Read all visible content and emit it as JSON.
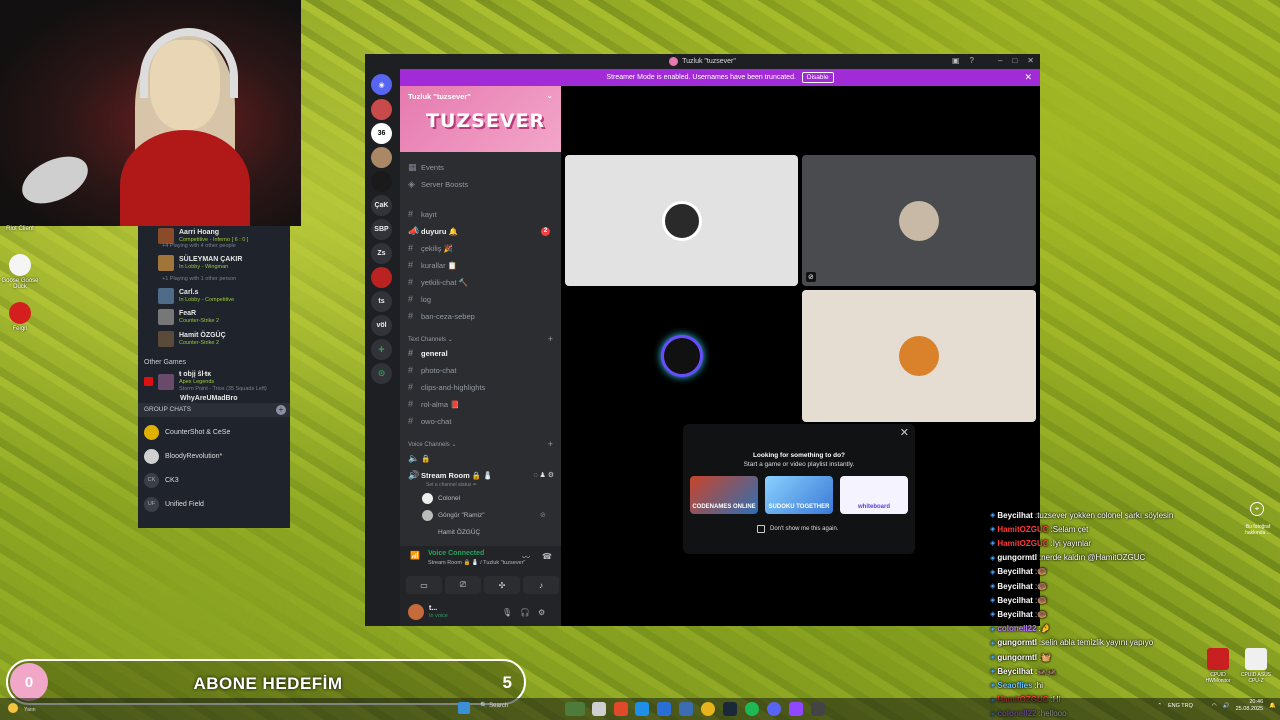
{
  "desktop": {
    "icons": [
      {
        "label": "Riot Client"
      },
      {
        "label": "Goose Goose Duck"
      },
      {
        "label": "Feign"
      }
    ]
  },
  "friends": {
    "playing_top_name": "Aarri Hoang",
    "playing_top_status": "Competitive - Inferno [ 6 : 0 ]",
    "playing_top_extra": "+4  Playing with 4 other people",
    "items": [
      {
        "name": "SÜLEYMAN ÇAKIR",
        "status": "In Lobby - Wingman",
        "extra": "+1  Playing with 1 other person"
      },
      {
        "name": "Carl.s",
        "status": "In Lobby - Competitive"
      },
      {
        "name": "FeaR",
        "status": "Counter-Strike 2"
      },
      {
        "name": "Hamit ÖZGÜÇ",
        "status": "Counter-Strike 2"
      }
    ],
    "other_games_label": "Other Games",
    "other_games": [
      {
        "name": "ŧ objį ŝŀŧĸ",
        "status": "Apex Legends",
        "extra": "Storm Point - Trios (35 Squads Left)"
      },
      {
        "name": "WhyAreUMadBro",
        "status": ""
      }
    ],
    "group_chats_label": "GROUP CHATS",
    "group_chats": [
      {
        "name": "CounterShot & CeSe",
        "initials": ""
      },
      {
        "name": "BloodyRevolution*",
        "initials": ""
      },
      {
        "name": "CK3",
        "initials": "CK"
      },
      {
        "name": "Unified Field",
        "initials": "UF"
      }
    ]
  },
  "discord": {
    "window_title": "Tuzluk \"tuzsever\"",
    "streamer_banner": "Streamer Mode is enabled. Usernames have been truncated.",
    "disable_label": "Disable",
    "servers": [
      "36",
      "ÇaK",
      "SBP",
      "Zs",
      "ts",
      "völ"
    ],
    "guild_name": "Tuzluk \"tuzsever\"",
    "banner_text": "TUZSEVER",
    "top_items": [
      "Events",
      "Server Boosts"
    ],
    "channels": [
      {
        "name": "kayıt",
        "bold": false
      },
      {
        "name": "duyuru 🔔",
        "bold": true,
        "badge": "2"
      },
      {
        "name": "çekiliş 🎉",
        "bold": false
      },
      {
        "name": "kurallar 📋",
        "bold": false
      },
      {
        "name": "yetkili-chat 🔨",
        "bold": false
      },
      {
        "name": "log",
        "bold": false
      },
      {
        "name": "ban-ceza-sebep",
        "bold": false
      }
    ],
    "text_category": "Text Channels",
    "text_channels": [
      {
        "name": "general",
        "bold": true
      },
      {
        "name": "photo-chat",
        "bold": false
      },
      {
        "name": "clips-and-highlights",
        "bold": false
      },
      {
        "name": "rol-alma 📕",
        "bold": false
      },
      {
        "name": "owo-chat",
        "bold": false
      }
    ],
    "voice_category": "Voice Channels",
    "voice_channel_locked": "🔒",
    "stream_room": "Stream Room 🔒 🧂",
    "stream_room_status": "Set a channel status ✏",
    "voice_users": [
      "Colonel",
      "Göngör \"Ramiz\"",
      "Hamit ÖZGÜÇ"
    ],
    "voice_connected": "Voice Connected",
    "voice_connected_sub": "Stream Room 🔒 🧂 / Tuzluk \"tuzsever\"",
    "user_name": "t...",
    "user_status": "In voice",
    "popup": {
      "title": "Looking for something to do?",
      "subtitle": "Start a game or video playlist instantly.",
      "games": [
        "CODENAMES ONLINE",
        "SUDOKU TOGETHER",
        "whiteboard"
      ],
      "dont_show": "Don't show me this again."
    }
  },
  "chat": {
    "messages": [
      {
        "user": "Beycilhat",
        "color": "#ffffff",
        "text": "tuzsever yokken colonel şarkı söylesin"
      },
      {
        "user": "HamitOZGUC",
        "color": "#ff3b3b",
        "text": "Selam çet"
      },
      {
        "user": "HamitOZGUC",
        "color": "#ff3b3b",
        "text": "İyi yayınlar"
      },
      {
        "user": "gungormtl",
        "color": "#ffffff",
        "text": "nerde kaldın @HamitOZGUC"
      },
      {
        "user": "Beycilhat",
        "color": "#ffffff",
        "text": "🍩"
      },
      {
        "user": "Beycilhat",
        "color": "#ffffff",
        "text": "🍩"
      },
      {
        "user": "Beycilhat",
        "color": "#ffffff",
        "text": "🍩"
      },
      {
        "user": "Beycilhat",
        "color": "#ffffff",
        "text": "🍩"
      },
      {
        "user": "colonell22",
        "color": "#b57bff",
        "text": "🤌"
      },
      {
        "user": "gungormtl",
        "color": "#ffffff",
        "text": "selin abla temizlik yayını yapıyo"
      },
      {
        "user": "gungormtl",
        "color": "#ffffff",
        "text": "🧺"
      },
      {
        "user": "Beycilhat",
        "color": "#ffffff",
        "text": "🦗🦗"
      },
      {
        "user": "Seaoflies",
        "color": "#6cc3ff",
        "text": "hi"
      },
      {
        "user": "HamitOZGUC",
        "color": "#ff3b3b",
        "text": "Hi"
      },
      {
        "user": "colonell22",
        "color": "#b57bff",
        "text": "hellooo"
      }
    ],
    "photo_note": "Bu fotoğraf hakkında ..."
  },
  "sub_goal": {
    "current": "0",
    "label": "ABONE HEDEFİM",
    "target": "5"
  },
  "taskbar": {
    "weather": "Yarın",
    "search_label": "Search",
    "lang": "ENG TRQ",
    "time": "20:46",
    "date": "25.08.2025",
    "tray_apps": [
      "CPUID HWMonitor",
      "CPUID ASUS CPU-Z"
    ]
  }
}
